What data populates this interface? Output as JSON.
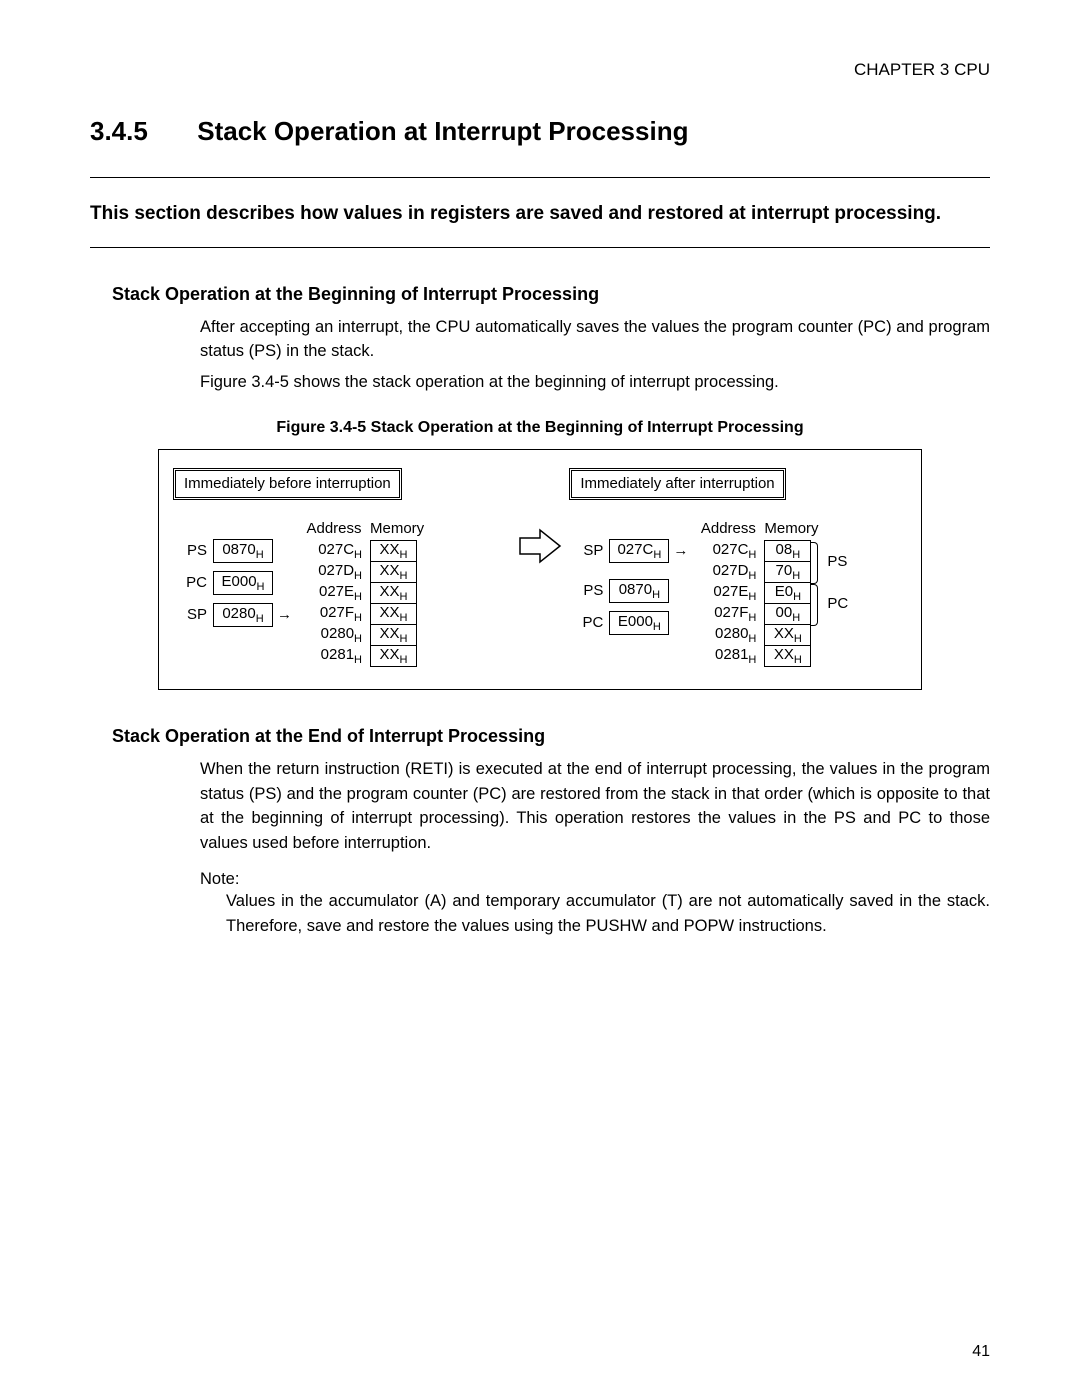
{
  "chapter_header": "CHAPTER 3  CPU",
  "section_number": "3.4.5",
  "section_title": "Stack Operation at Interrupt Processing",
  "intro": "This section describes how values in registers are saved and restored at interrupt processing.",
  "sub1_title": "Stack Operation at the Beginning of Interrupt Processing",
  "sub1_p1": "After accepting an interrupt, the CPU automatically saves the values the program counter (PC) and program status (PS) in the stack.",
  "sub1_p2": "Figure 3.4-5 shows the stack operation at the beginning of interrupt processing.",
  "figure_caption": "Figure 3.4-5  Stack Operation at the Beginning of Interrupt Processing",
  "before_label": "Immediately before interruption",
  "after_label": "Immediately after interruption",
  "col_addr": "Address",
  "col_mem": "Memory",
  "before_regs": {
    "PS": "0870",
    "PC": "E000",
    "SP": "0280"
  },
  "after_regs": {
    "SP": "027C",
    "PS": "0870",
    "PC": "E000"
  },
  "mem_addrs": [
    "027C",
    "027D",
    "027E",
    "027F",
    "0280",
    "0281"
  ],
  "before_mem": [
    "XX",
    "XX",
    "XX",
    "XX",
    "XX",
    "XX"
  ],
  "after_mem": [
    "08",
    "70",
    "E0",
    "00",
    "XX",
    "XX"
  ],
  "brace_ps": "PS",
  "brace_pc": "PC",
  "sub2_title": "Stack Operation at the End of Interrupt Processing",
  "sub2_p1": "When the return instruction (RETI) is executed at the end of interrupt processing, the values in the program status (PS) and the program counter (PC) are restored from the stack in that order (which is opposite to that at the beginning of interrupt processing). This operation restores the values in the PS and PC to those values used before interruption.",
  "note_label": "Note:",
  "note_text": "Values in the accumulator (A) and temporary accumulator (T) are not automatically saved in the stack. Therefore, save and restore the values using the PUSHW and POPW instructions.",
  "page_number": "41"
}
